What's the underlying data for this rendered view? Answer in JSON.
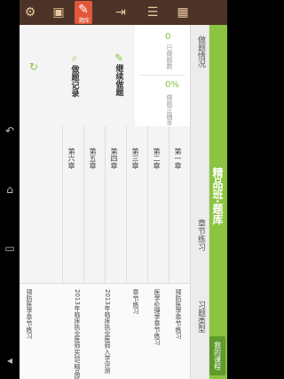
{
  "system_nav": {
    "icons": [
      "back-icon",
      "home-icon",
      "recent-icon",
      "volume-icon"
    ]
  },
  "toolbar": {
    "active_label": "题库",
    "icons": [
      "settings-icon",
      "app-icon",
      "quiz-icon",
      "exit-icon",
      "notes-icon",
      "grid-icon"
    ]
  },
  "header": {
    "title": "精品班·题库",
    "button_label": "我的课程"
  },
  "stats": {
    "section_label": "做题情况",
    "done_value": "0",
    "done_label": "已做题数",
    "rate_value": "0%",
    "rate_label": "做题正确率"
  },
  "quick": {
    "continue_label": "继续做题",
    "record_label": "做题记录"
  },
  "chapters": {
    "section_label": "章节练习",
    "items": [
      "第一章",
      "第二章",
      "第三章",
      "第四章",
      "第五章",
      "第六章"
    ]
  },
  "categories": {
    "section_label": "习题类型",
    "items": [
      "预防医学章节练习",
      "医学伦理学章节练习",
      "章节练习",
      "2013年临床执业医师入学评测",
      "2013年临床执业医师实验/精品班模拟试卷"
    ],
    "footer": "预防医学章节练习"
  }
}
